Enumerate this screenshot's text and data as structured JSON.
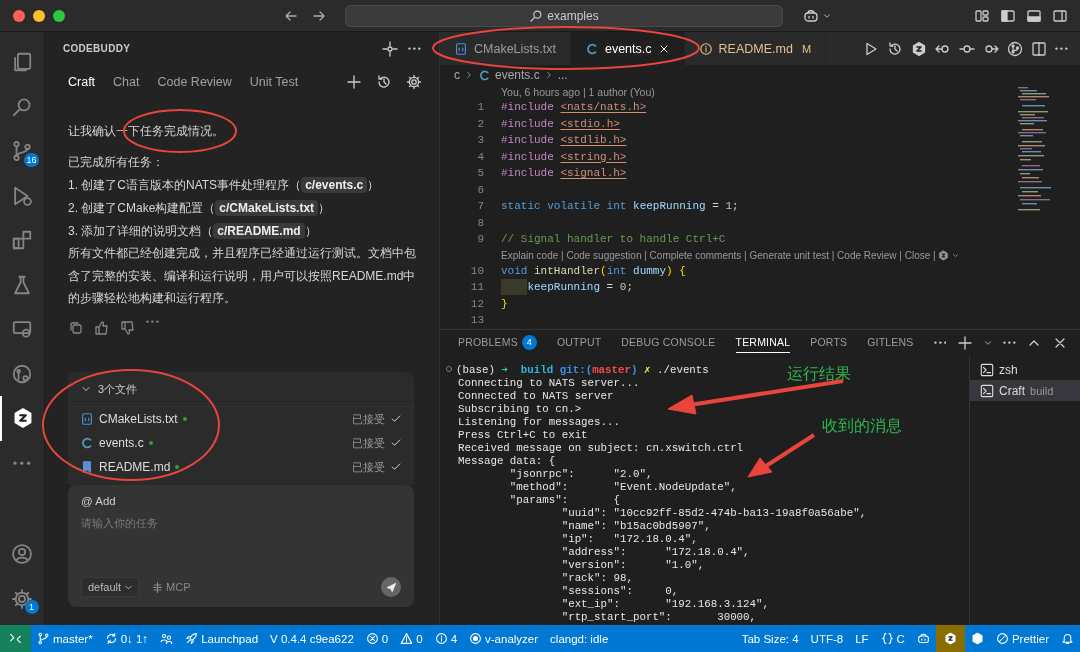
{
  "title_bar": {
    "search": "examples"
  },
  "activity_bar": {
    "items": [
      {
        "kind": "files",
        "selected": false
      },
      {
        "kind": "search",
        "selected": false
      },
      {
        "kind": "source-control",
        "selected": false,
        "badge": "16"
      },
      {
        "kind": "run-debug",
        "selected": false
      },
      {
        "kind": "extensions",
        "selected": false
      },
      {
        "kind": "flask",
        "selected": false
      },
      {
        "kind": "remote",
        "selected": false
      },
      {
        "kind": "git-graph",
        "selected": false
      },
      {
        "kind": "codebuddy",
        "selected": true
      },
      {
        "kind": "more",
        "selected": false
      }
    ],
    "bottom": [
      {
        "kind": "account"
      },
      {
        "kind": "gear",
        "badge": "1"
      }
    ]
  },
  "side_panel": {
    "title": "CODEBUDDY",
    "tabs": [
      {
        "label": "Craft",
        "selected": true
      },
      {
        "label": "Chat",
        "selected": false
      },
      {
        "label": "Code Review",
        "selected": false
      },
      {
        "label": "Unit Test",
        "selected": false
      }
    ],
    "messages": [
      [
        {
          "kind": "text",
          "text": "让我确认一下任务完成情况。"
        }
      ],
      [
        {
          "kind": "text",
          "text": "已完成所有任务："
        }
      ],
      [
        {
          "kind": "text",
          "text": "1. 创建了C语言版本的NATS事件处理程序（"
        },
        {
          "kind": "code",
          "text": "c/events.c"
        },
        {
          "kind": "text",
          "text": "）"
        }
      ],
      [
        {
          "kind": "text",
          "text": "2. 创建了CMake构建配置（"
        },
        {
          "kind": "code",
          "text": "c/CMakeLists.txt"
        },
        {
          "kind": "text",
          "text": "）"
        }
      ],
      [
        {
          "kind": "text",
          "text": "3. 添加了详细的说明文档（"
        },
        {
          "kind": "code",
          "text": "c/README.md"
        },
        {
          "kind": "text",
          "text": "）"
        }
      ],
      [
        {
          "kind": "text",
          "text": "所有文件都已经创建完成，并且程序已经通过运行测试。文档中包含了完整的安装、编译和运行说明，用户可以按照README.md中的步骤轻松地构建和运行程序。"
        }
      ]
    ],
    "files": {
      "title": "3个文件",
      "expanded": true,
      "items": [
        {
          "kind": "cmake",
          "name": "CMakeLists.txt",
          "status": "已接受"
        },
        {
          "kind": "c",
          "name": "events.c",
          "status": "已接受"
        },
        {
          "kind": "markdown",
          "name": "README.md",
          "status": "已接受"
        }
      ]
    },
    "composer": {
      "mention": "@ Add",
      "placeholder": "请输入你的任务",
      "mode": "default",
      "tool": "MCP"
    }
  },
  "editor": {
    "tabs": [
      {
        "kind": "cmake",
        "label": "CMakeLists.txt",
        "selected": false
      },
      {
        "kind": "c",
        "label": "events.c",
        "selected": true
      },
      {
        "kind": "info",
        "label": "README.md",
        "selected": false,
        "modified": "M"
      }
    ],
    "breadcrumb": [
      "c",
      "events.c",
      "..."
    ],
    "blame": "You, 6 hours ago | 1 author (You)",
    "lines": [
      {
        "kind": "code",
        "number": "1",
        "tokens": [
          {
            "kind": "directive",
            "text": "#include "
          },
          {
            "kind": "header",
            "text": "<nats/nats.h>"
          }
        ]
      },
      {
        "kind": "code",
        "number": "2",
        "tokens": [
          {
            "kind": "directive",
            "text": "#include "
          },
          {
            "kind": "header",
            "text": "<stdio.h>"
          }
        ]
      },
      {
        "kind": "code",
        "number": "3",
        "tokens": [
          {
            "kind": "directive",
            "text": "#include "
          },
          {
            "kind": "header",
            "text": "<stdlib.h>"
          }
        ]
      },
      {
        "kind": "code",
        "number": "4",
        "tokens": [
          {
            "kind": "directive",
            "text": "#include "
          },
          {
            "kind": "header",
            "text": "<string.h>"
          }
        ]
      },
      {
        "kind": "code",
        "number": "5",
        "tokens": [
          {
            "kind": "directive",
            "text": "#include "
          },
          {
            "kind": "header",
            "text": "<signal.h>"
          }
        ]
      },
      {
        "kind": "code",
        "number": "6"
      },
      {
        "kind": "code",
        "number": "7",
        "tokens": [
          {
            "kind": "keyword",
            "text": "static volatile int "
          },
          {
            "kind": "ident",
            "text": "keepRunning"
          },
          {
            "kind": "plain",
            "text": " = "
          },
          {
            "kind": "number",
            "text": "1"
          },
          {
            "kind": "plain",
            "text": ";"
          }
        ]
      },
      {
        "kind": "code",
        "number": "8"
      },
      {
        "kind": "code",
        "number": "9",
        "tokens": [
          {
            "kind": "comment",
            "text": "// Signal handler to handle Ctrl+C"
          }
        ]
      },
      {
        "kind": "lens",
        "text": "Explain code | Code suggestion | Complete comments | Generate unit test | Code Review | Close |"
      },
      {
        "kind": "code",
        "number": "10",
        "tokens": [
          {
            "kind": "keyword",
            "text": "void "
          },
          {
            "kind": "function",
            "text": "intHandler"
          },
          {
            "kind": "brace",
            "text": "("
          },
          {
            "kind": "keyword",
            "text": "int "
          },
          {
            "kind": "ident",
            "text": "dummy"
          },
          {
            "kind": "brace",
            "text": ")"
          },
          {
            "kind": "brace",
            "text": " {"
          }
        ]
      },
      {
        "kind": "code",
        "number": "11",
        "indented": true,
        "indent_highlight": true,
        "tokens": [
          {
            "kind": "ident",
            "text": "keepRunning"
          },
          {
            "kind": "plain",
            "text": " = "
          },
          {
            "kind": "number",
            "text": "0"
          },
          {
            "kind": "plain",
            "text": ";"
          }
        ]
      },
      {
        "kind": "code",
        "number": "12",
        "tokens": [
          {
            "kind": "brace",
            "text": "}"
          }
        ]
      },
      {
        "kind": "code",
        "number": "13"
      }
    ]
  },
  "panel": {
    "tabs": [
      {
        "label": "PROBLEMS",
        "selected": false,
        "badge": "4"
      },
      {
        "label": "OUTPUT",
        "selected": false
      },
      {
        "label": "DEBUG CONSOLE",
        "selected": false
      },
      {
        "label": "TERMINAL",
        "selected": true
      },
      {
        "label": "PORTS",
        "selected": false
      },
      {
        "label": "GITLENS",
        "selected": false
      }
    ],
    "terminal": [
      [
        {
          "kind": "white",
          "text": "(base) "
        },
        {
          "kind": "green",
          "text": "➜  "
        },
        {
          "kind": "cyan",
          "text": "build "
        },
        {
          "kind": "blue",
          "text": "git:("
        },
        {
          "kind": "red",
          "text": "master"
        },
        {
          "kind": "blue",
          "text": ")"
        },
        {
          "kind": "yellow",
          "text": " ✗"
        },
        {
          "kind": "white",
          "text": " ./events"
        }
      ],
      [
        {
          "kind": "white",
          "text": "Connecting to NATS server..."
        }
      ],
      [
        {
          "kind": "white",
          "text": "Connected to NATS server"
        }
      ],
      [
        {
          "kind": "white",
          "text": "Subscribing to cn.>"
        }
      ],
      [
        {
          "kind": "white",
          "text": "Listening for messages..."
        }
      ],
      [
        {
          "kind": "white",
          "text": "Press Ctrl+C to exit"
        }
      ],
      [
        {
          "kind": "white",
          "text": "Received message on subject: cn.xswitch.ctrl"
        }
      ],
      [
        {
          "kind": "white",
          "text": "Message data: {"
        }
      ],
      [
        {
          "kind": "white",
          "text": "        \"jsonrpc\":      \"2.0\","
        }
      ],
      [
        {
          "kind": "white",
          "text": "        \"method\":       \"Event.NodeUpdate\","
        }
      ],
      [
        {
          "kind": "white",
          "text": "        \"params\":       {"
        }
      ],
      [
        {
          "kind": "white",
          "text": "                \"uuid\": \"10cc92ff-85d2-474b-ba13-19a8f0a56abe\","
        }
      ],
      [
        {
          "kind": "white",
          "text": "                \"name\": \"b15ac0bd5907\","
        }
      ],
      [
        {
          "kind": "white",
          "text": "                \"ip\":   \"172.18.0.4\","
        }
      ],
      [
        {
          "kind": "white",
          "text": "                \"address\":      \"172.18.0.4\","
        }
      ],
      [
        {
          "kind": "white",
          "text": "                \"version\":      \"1.0\","
        }
      ],
      [
        {
          "kind": "white",
          "text": "                \"rack\": 98,"
        }
      ],
      [
        {
          "kind": "white",
          "text": "                \"sessions\":     0,"
        }
      ],
      [
        {
          "kind": "white",
          "text": "                \"ext_ip\":       \"192.168.3.124\","
        }
      ],
      [
        {
          "kind": "white",
          "text": "                \"rtp_start_port\":       30000,"
        }
      ]
    ],
    "annotations": [
      "运行结果",
      "收到的消息"
    ],
    "sessions": [
      {
        "name": "zsh",
        "selected": false
      },
      {
        "name": "Craft",
        "detail": "build",
        "selected": true
      }
    ]
  },
  "status_bar": {
    "left": [
      {
        "kind": "remote"
      },
      {
        "kind": "branch",
        "text": "master*"
      },
      {
        "kind": "sync",
        "text": "0↓ 1↑"
      },
      {
        "kind": "live-share"
      },
      {
        "kind": "launchpad",
        "text": "Launchpad"
      },
      {
        "kind": "text",
        "text": "V 0.4.4 c9ea622"
      },
      {
        "kind": "errors",
        "text": "0"
      },
      {
        "kind": "warnings",
        "text": "0"
      },
      {
        "kind": "infos",
        "text": "4"
      },
      {
        "kind": "analyzer",
        "text": "v-analyzer"
      },
      {
        "kind": "text",
        "text": "clangd: idle"
      }
    ],
    "right": [
      {
        "kind": "text",
        "text": "Tab Size: 4"
      },
      {
        "kind": "text",
        "text": "UTF-8"
      },
      {
        "kind": "text",
        "text": "LF"
      },
      {
        "kind": "language",
        "text": "C"
      },
      {
        "kind": "copilot"
      },
      {
        "kind": "codebuddy"
      },
      {
        "kind": "extension"
      },
      {
        "kind": "formatter",
        "text": "Prettier"
      },
      {
        "kind": "notifications"
      }
    ]
  }
}
